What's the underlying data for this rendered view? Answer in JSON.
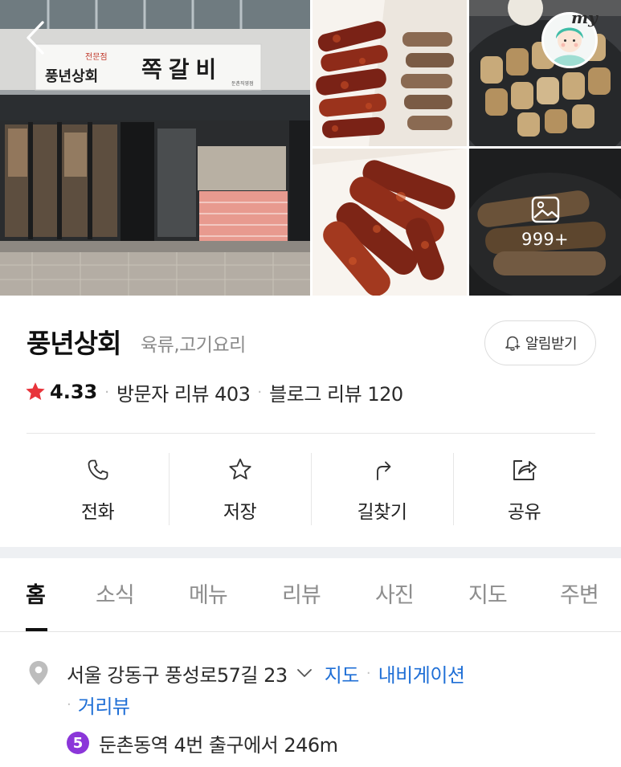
{
  "header": {
    "back_icon": "chevron-left-icon",
    "profile_tag": "my",
    "store_sign": {
      "chain_name": "풍년상회",
      "tagline": "전문점",
      "main_text": "쪽갈비",
      "branch": "둔촌직영점"
    },
    "more_photos_icon": "image-icon",
    "more_photos_count": "999+"
  },
  "place": {
    "name": "풍년상회",
    "category": "육류,고기요리",
    "notify_label": "알림받기",
    "rating_icon": "star-icon",
    "rating": "4.33",
    "visitor_reviews": "방문자 리뷰 403",
    "blog_reviews": "블로그 리뷰 120",
    "star_color": "#e8343b"
  },
  "actions": [
    {
      "id": "call",
      "label": "전화",
      "icon": "phone-icon"
    },
    {
      "id": "save",
      "label": "저장",
      "icon": "star-outline-icon"
    },
    {
      "id": "directions",
      "label": "길찾기",
      "icon": "turn-arrow-icon"
    },
    {
      "id": "share",
      "label": "공유",
      "icon": "share-icon"
    }
  ],
  "tabs": [
    {
      "label": "홈",
      "active": true
    },
    {
      "label": "소식"
    },
    {
      "label": "메뉴"
    },
    {
      "label": "리뷰"
    },
    {
      "label": "사진"
    },
    {
      "label": "지도"
    },
    {
      "label": "주변"
    }
  ],
  "address": {
    "pin_icon": "location-pin-icon",
    "text": "서울 강동구 풍성로57길 23",
    "expand_icon": "chevron-down-icon",
    "map_link": "지도",
    "navigation_link": "내비게이션",
    "street_view_link": "거리뷰",
    "link_color": "#1f6fd6"
  },
  "subway": {
    "line_number": "5",
    "line_color": "#8b36d9",
    "text": "둔촌동역 4번 출구에서 246m"
  }
}
